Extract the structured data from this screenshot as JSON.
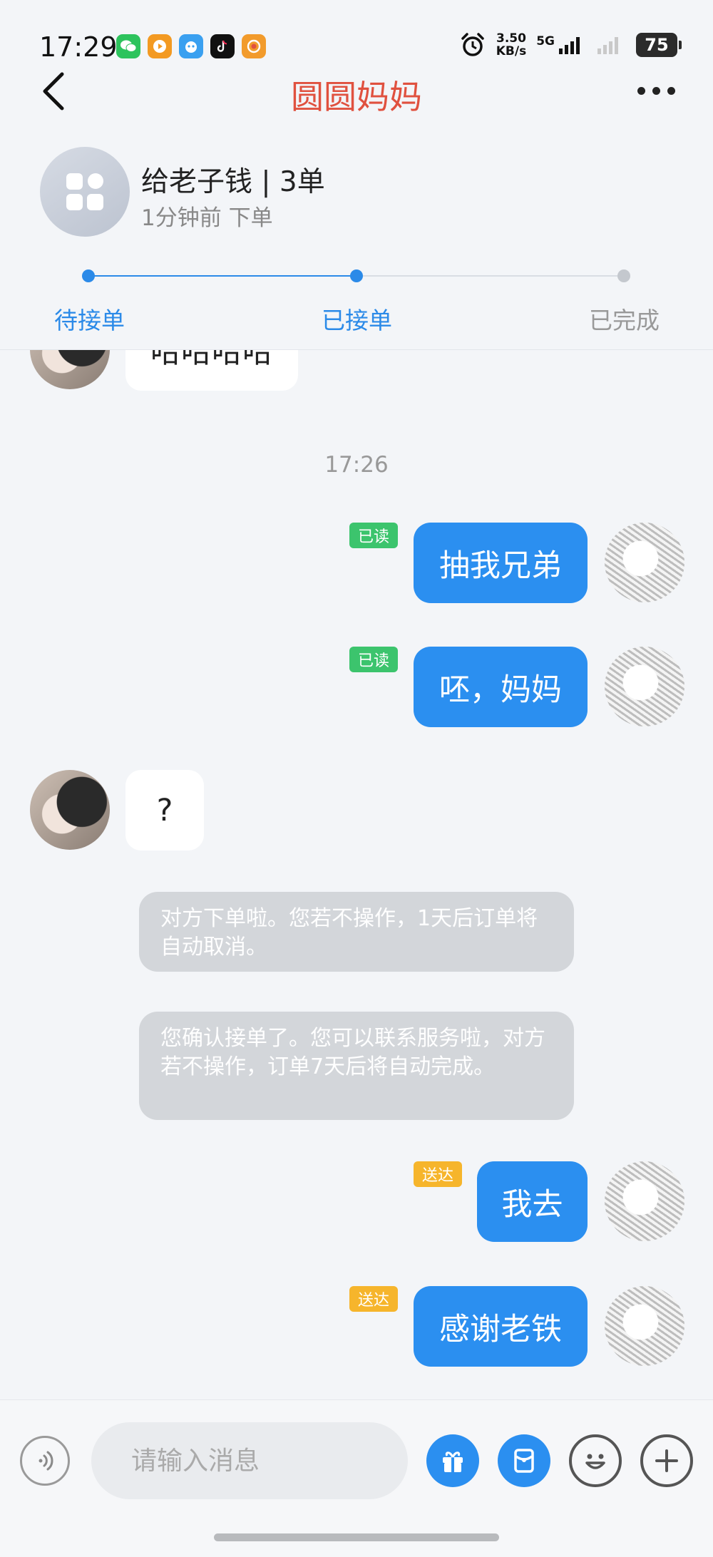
{
  "status_bar": {
    "time": "17:29",
    "net_speed_value": "3.50",
    "net_speed_unit": "KB/s",
    "network_type": "5G",
    "battery": "75",
    "apps": [
      "wechat-icon",
      "video-app-icon",
      "message-app-icon",
      "tiktok-icon",
      "camera-app-icon"
    ]
  },
  "header": {
    "title": "圆圆妈妈",
    "title_color": "#e0513f"
  },
  "order": {
    "title": "给老子钱 | 3单",
    "subtitle": "1分钟前 下单"
  },
  "progress": {
    "steps": [
      "待接单",
      "已接单",
      "已完成"
    ],
    "current_step": 2,
    "active_color": "#2b8ae8",
    "inactive_color": "#999999"
  },
  "chat": {
    "messages": [
      {
        "side": "left",
        "text": "哈哈哈哈"
      },
      {
        "side": "time",
        "text": "17:26"
      },
      {
        "side": "right",
        "text": "抽我兄弟",
        "status": "已读"
      },
      {
        "side": "right",
        "text": "呸，妈妈",
        "status": "已读"
      },
      {
        "side": "left",
        "text": "?"
      },
      {
        "side": "system",
        "text": "对方下单啦。您若不操作，1天后订单将自动取消。"
      },
      {
        "side": "system",
        "text": "您确认接单了。您可以联系服务啦，对方若不操作，订单7天后将自动完成。"
      },
      {
        "side": "right",
        "text": "我去",
        "status": "送达"
      },
      {
        "side": "right",
        "text": "感谢老铁",
        "status": "送达"
      }
    ],
    "colors": {
      "outgoing_bubble": "#2b8ff0",
      "incoming_bubble": "#ffffff",
      "read_tag": "#3cc46d",
      "delivered_tag": "#f6b52c",
      "system_bubble": "#d3d6da"
    }
  },
  "input_bar": {
    "placeholder": "请输入消息",
    "buttons": [
      "voice-icon",
      "gift-icon",
      "red-packet-icon",
      "emoji-icon",
      "plus-icon"
    ]
  }
}
